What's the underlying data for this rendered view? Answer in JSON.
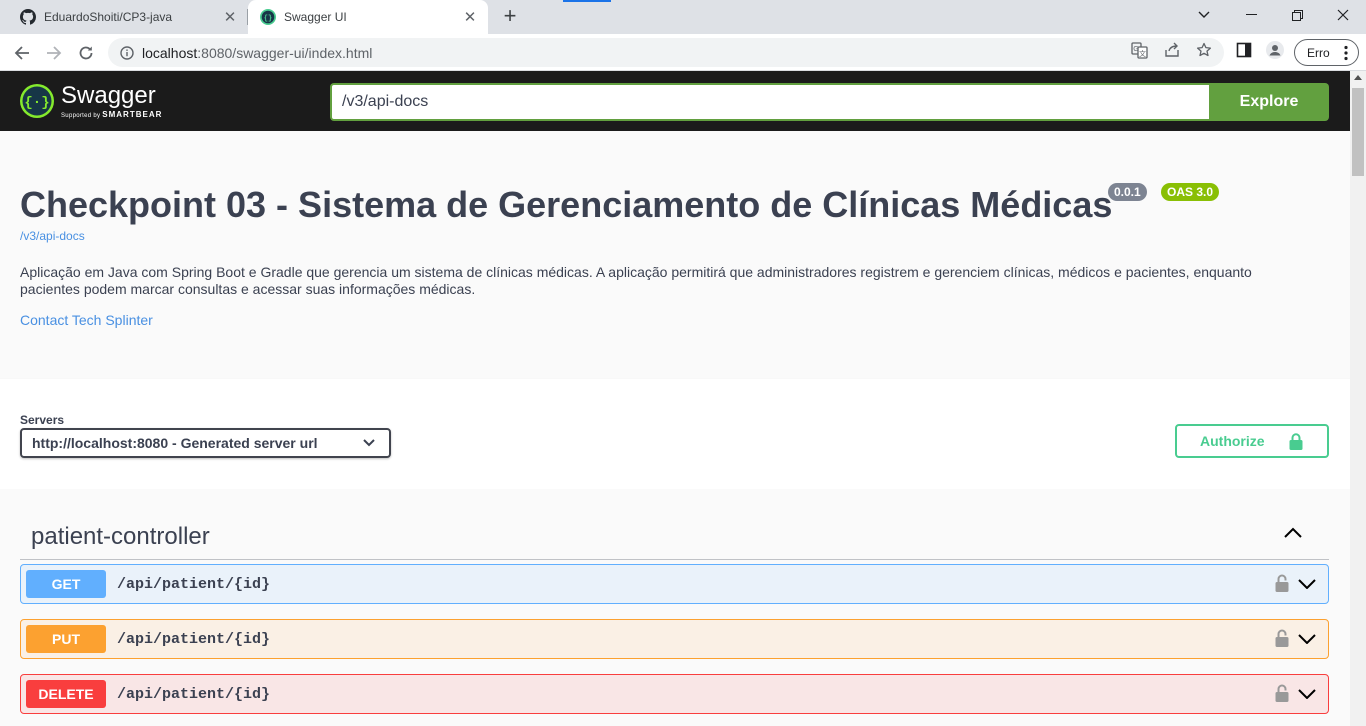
{
  "browser": {
    "tabs": [
      {
        "title": "EduardoShoiti/CP3-java",
        "icon": "github-icon"
      },
      {
        "title": "Swagger UI",
        "icon": "swagger-icon"
      }
    ],
    "address": {
      "host": "localhost",
      "rest": ":8080/swagger-ui/index.html"
    },
    "profile_button": "Erro"
  },
  "swagger": {
    "brand": "Swagger",
    "brand_sub_prefix": "Supported by",
    "brand_sub_name": "SMARTBEAR",
    "definition_url": "/v3/api-docs",
    "explore_label": "Explore"
  },
  "info": {
    "title": "Checkpoint 03 - Sistema de Gerenciamento de Clínicas Médicas",
    "version": "0.0.1",
    "oas": "OAS 3.0",
    "docs_link": "/v3/api-docs",
    "description": "Aplicação em Java com Spring Boot e Gradle que gerencia um sistema de clínicas médicas. A aplicação permitirá que administradores registrem e gerenciem clínicas, médicos e pacientes, enquanto pacientes podem marcar consultas e acessar suas informações médicas.",
    "contact": "Contact Tech Splinter"
  },
  "servers": {
    "label": "Servers",
    "selected": "http://localhost:8080 - Generated server url",
    "authorize_label": "Authorize"
  },
  "tag": {
    "name": "patient-controller",
    "operations": [
      {
        "method": "GET",
        "path": "/api/patient/{id}"
      },
      {
        "method": "PUT",
        "path": "/api/patient/{id}"
      },
      {
        "method": "DELETE",
        "path": "/api/patient/{id}"
      }
    ]
  },
  "colors": {
    "get": "#61affe",
    "put": "#fca130",
    "delete": "#f93e3e",
    "swagger_green": "#62a03f",
    "authorize_green": "#49cc90",
    "oas_badge": "#89bf04",
    "version_badge": "#7d8492"
  }
}
